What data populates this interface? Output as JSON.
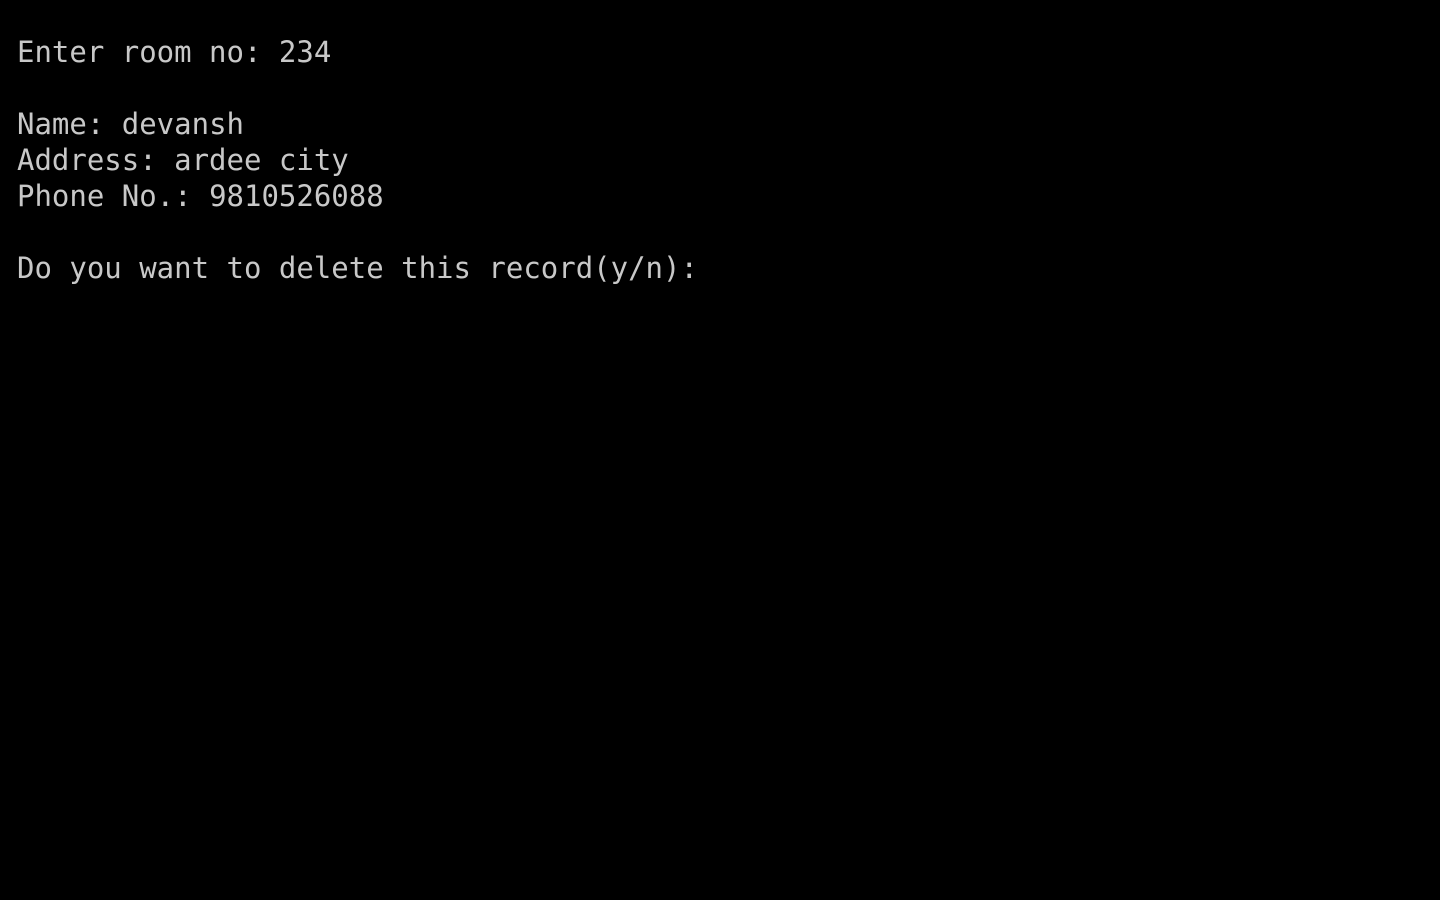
{
  "console": {
    "room_prompt": "Enter room no: ",
    "room_value": "234",
    "name_label": "Name: ",
    "name_value": "devansh",
    "address_label": "Address: ",
    "address_value": "ardee city",
    "phone_label": "Phone No.: ",
    "phone_value": "9810526088",
    "delete_prompt": "Do you want to delete this record(y/n):",
    "text_color": "#c8c8c8",
    "background_color": "#000000"
  }
}
